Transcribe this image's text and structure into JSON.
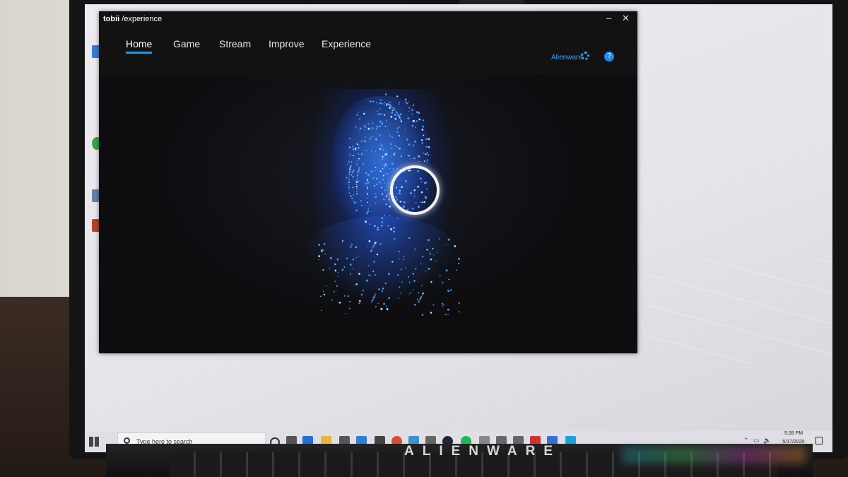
{
  "app": {
    "logo_main": "tobii",
    "logo_sub": " /experience",
    "minimize": "–",
    "close": "✕",
    "tabs": [
      {
        "label": "Home",
        "active": true
      },
      {
        "label": "Game",
        "active": false
      },
      {
        "label": "Stream",
        "active": false
      },
      {
        "label": "Improve",
        "active": false
      },
      {
        "label": "Experience",
        "active": false
      }
    ],
    "profile_label": "Alienware",
    "help_label": "?"
  },
  "taskbar": {
    "search_placeholder": "Type here to search",
    "time": "5:28 PM",
    "date": "5/17/2020",
    "icons": [
      "cortana-icon",
      "task-view-icon",
      "edge-icon",
      "file-explorer-icon",
      "store-icon",
      "mail-icon",
      "settings-icon",
      "chrome-icon",
      "notepad-icon",
      "network-icon",
      "steam-icon",
      "spotify-icon",
      "alienware-icon",
      "mic-icon",
      "chat-icon",
      "media-icon",
      "photos-icon",
      "tobii-taskbar-icon"
    ]
  },
  "laptop_brand": "ALIENWARE",
  "colors": {
    "accent": "#1f9be8",
    "alienware_blue": "#3aa6ff",
    "app_bg": "#121212",
    "particle": "#4a9dff"
  }
}
